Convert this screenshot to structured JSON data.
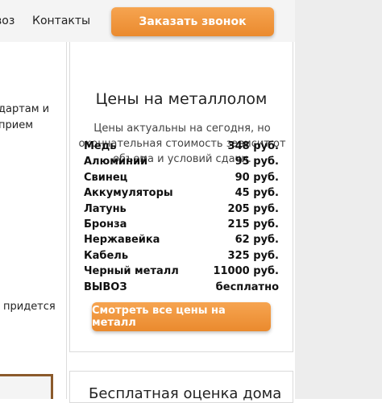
{
  "nav": {
    "item_partial": "воз",
    "contacts": "Контакты"
  },
  "header": {
    "call_button": "Заказать звонок"
  },
  "left": {
    "line1": "дартам и",
    "line2": "прием",
    "line3": "придется"
  },
  "prices_card": {
    "title": "Цены на металлолом",
    "subtitle": "Цены актуальны на сегодня, но окончательная стоимость зависит от объема и условий сдачи.",
    "items": [
      {
        "name": "Медь",
        "price": "348 руб."
      },
      {
        "name": "Алюминий",
        "price": "95 руб."
      },
      {
        "name": "Свинец",
        "price": "90 руб."
      },
      {
        "name": "Аккумуляторы",
        "price": "45 руб."
      },
      {
        "name": "Латунь",
        "price": "205 руб."
      },
      {
        "name": "Бронза",
        "price": "215 руб."
      },
      {
        "name": "Нержавейка",
        "price": "62 руб."
      },
      {
        "name": "Кабель",
        "price": "325 руб."
      },
      {
        "name": "Черный металл",
        "price": "11000 руб."
      },
      {
        "name": "ВЫВОЗ",
        "price": "бесплатно"
      }
    ],
    "button": "Смотреть все цены на металл"
  },
  "next_card": {
    "title": "Бесплатная оценка дома"
  }
}
